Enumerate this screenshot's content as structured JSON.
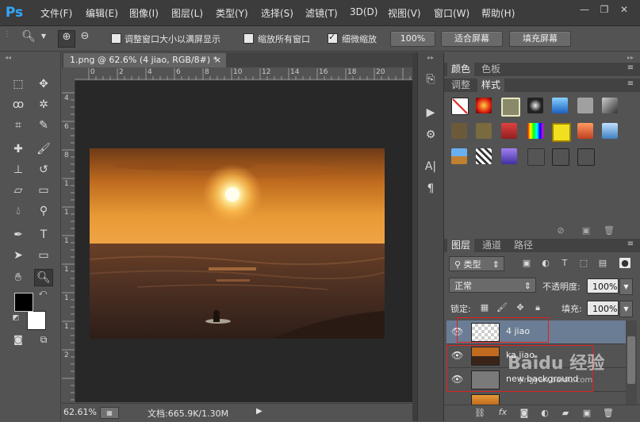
{
  "app": {
    "logo": "Ps"
  },
  "menu": [
    "文件(F)",
    "编辑(E)",
    "图像(I)",
    "图层(L)",
    "类型(Y)",
    "选择(S)",
    "滤镜(T)",
    "3D(D)",
    "视图(V)",
    "窗口(W)",
    "帮助(H)"
  ],
  "window_controls": {
    "minimize": "—",
    "restore": "❐",
    "close": "✕"
  },
  "options": {
    "resize_windows_label": "调整窗口大小以满屏显示",
    "zoom_all_label": "缩放所有窗口",
    "scrubby_zoom_label": "细微缩放",
    "zoom_100": "100%",
    "fit_screen": "适合屏幕",
    "fill_screen": "填充屏幕"
  },
  "document": {
    "tab_title": "1.png @ 62.6% (4 jiao, RGB/8#) *",
    "tab_close": "×",
    "ruler_h": [
      "0",
      "2",
      "4",
      "6",
      "8",
      "10",
      "12",
      "14",
      "16",
      "18",
      "20"
    ],
    "ruler_v": [
      "4",
      "6",
      "8",
      "1",
      "1",
      "1",
      "1",
      "1",
      "1",
      "2"
    ],
    "status_zoom": "62.61%",
    "status_doc": "文档:665.9K/1.30M"
  },
  "panels": {
    "color_tabs": [
      "颜色",
      "色板"
    ],
    "style_tabs": [
      "调整",
      "样式"
    ],
    "layer_tabs": [
      "图层",
      "通道",
      "路径"
    ],
    "filter_kind": "类型",
    "blend_mode": "正常",
    "opacity_label": "不透明度:",
    "opacity_value": "100%",
    "lock_label": "锁定:",
    "fill_label": "填充:",
    "fill_value": "100%",
    "layers": [
      {
        "name": "4 jiao",
        "selected": true
      },
      {
        "name": "ka jiao",
        "selected": false
      },
      {
        "name": "new background",
        "selected": false
      }
    ]
  },
  "watermark": "Baidu 经验",
  "watermark_url": "jingyan.baidu.com"
}
